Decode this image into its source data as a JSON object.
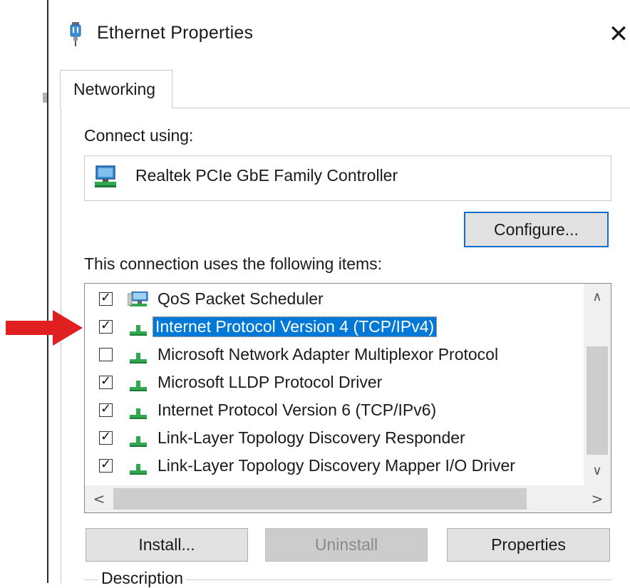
{
  "window": {
    "title": "Ethernet Properties",
    "close_glyph": "✕",
    "title_icon": "network-adapter-icon"
  },
  "tabs": [
    {
      "label": "Networking",
      "active": true
    }
  ],
  "connect_using": {
    "label": "Connect using:",
    "adapter_name": "Realtek PCIe GbE Family Controller",
    "adapter_icon": "network-adapter-icon"
  },
  "buttons": {
    "configure": "Configure...",
    "install": "Install...",
    "uninstall": "Uninstall",
    "properties": "Properties"
  },
  "items_label": "This connection uses the following items:",
  "items": [
    {
      "label": "QoS Packet Scheduler",
      "checked": true,
      "icon": "qos-scheduler-icon",
      "selected": false
    },
    {
      "label": "Internet Protocol Version 4 (TCP/IPv4)",
      "checked": true,
      "icon": "protocol-icon",
      "selected": true
    },
    {
      "label": "Microsoft Network Adapter Multiplexor Protocol",
      "checked": false,
      "icon": "protocol-icon",
      "selected": false
    },
    {
      "label": "Microsoft LLDP Protocol Driver",
      "checked": true,
      "icon": "protocol-icon",
      "selected": false
    },
    {
      "label": "Internet Protocol Version 6 (TCP/IPv6)",
      "checked": true,
      "icon": "protocol-icon",
      "selected": false
    },
    {
      "label": "Link-Layer Topology Discovery Responder",
      "checked": true,
      "icon": "protocol-icon",
      "selected": false
    },
    {
      "label": "Link-Layer Topology Discovery Mapper I/O Driver",
      "checked": true,
      "icon": "protocol-icon",
      "selected": false
    }
  ],
  "description_label": "Description",
  "check_glyph": "✓",
  "scroll_glyphs": {
    "up": "∧",
    "down": "∨",
    "left": "<",
    "right": ">"
  },
  "colors": {
    "selection": "#0078d7",
    "focus_border": "#0f6fc6",
    "annotation_arrow": "#e02020"
  }
}
